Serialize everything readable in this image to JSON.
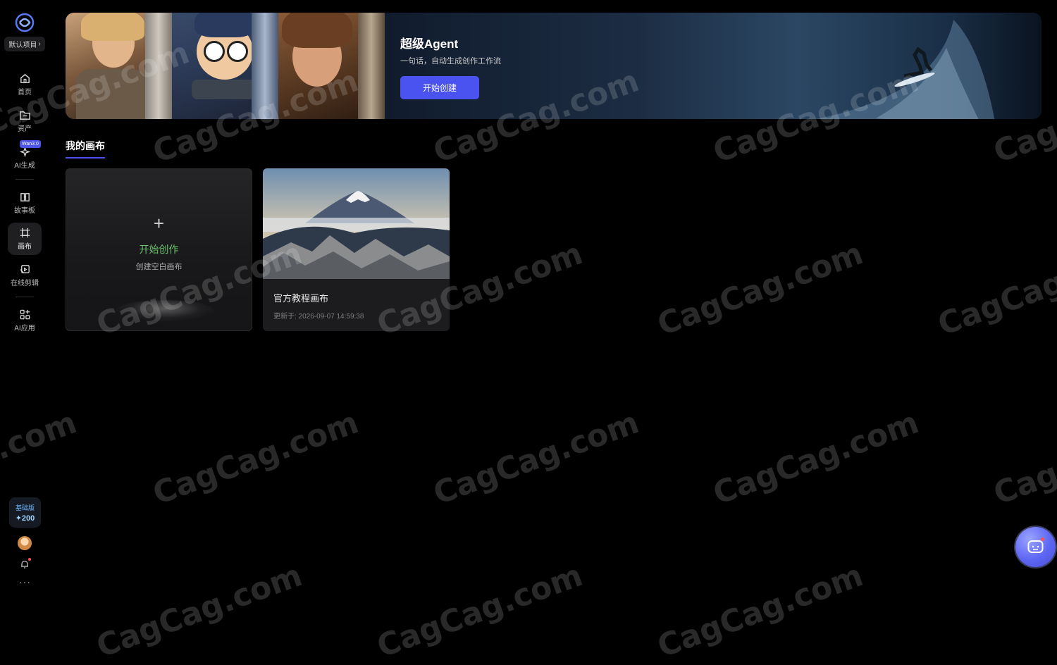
{
  "sidebar": {
    "project": "默认项目",
    "nav": [
      {
        "label": "首页",
        "icon": "home-icon"
      },
      {
        "label": "资产",
        "icon": "folder-icon"
      },
      {
        "label": "AI生成",
        "icon": "sparkle-icon",
        "badge": "Wan3.0"
      },
      {
        "label": "故事板",
        "icon": "storyboard-icon"
      },
      {
        "label": "画布",
        "icon": "canvas-icon",
        "active": true
      },
      {
        "label": "在线剪辑",
        "icon": "edit-icon"
      },
      {
        "label": "AI应用",
        "icon": "apps-icon"
      }
    ],
    "plan": {
      "name": "基础版",
      "credits": "200"
    },
    "more": "···"
  },
  "banner": {
    "title": "超级Agent",
    "subtitle": "一句话，自动生成创作工作流",
    "button": "开始创建"
  },
  "section": {
    "tab": "我的画布"
  },
  "cards": {
    "new": {
      "plus": "+",
      "title": "开始创作",
      "subtitle": "创建空白画布"
    },
    "tutorial": {
      "title": "官方教程画布",
      "date": "更新于: 2026-09-07 14:59:38"
    }
  },
  "watermark": "CagCag.com",
  "colors": {
    "accent": "#4a52f0",
    "new_title": "#6ac56b",
    "background": "#000000"
  }
}
